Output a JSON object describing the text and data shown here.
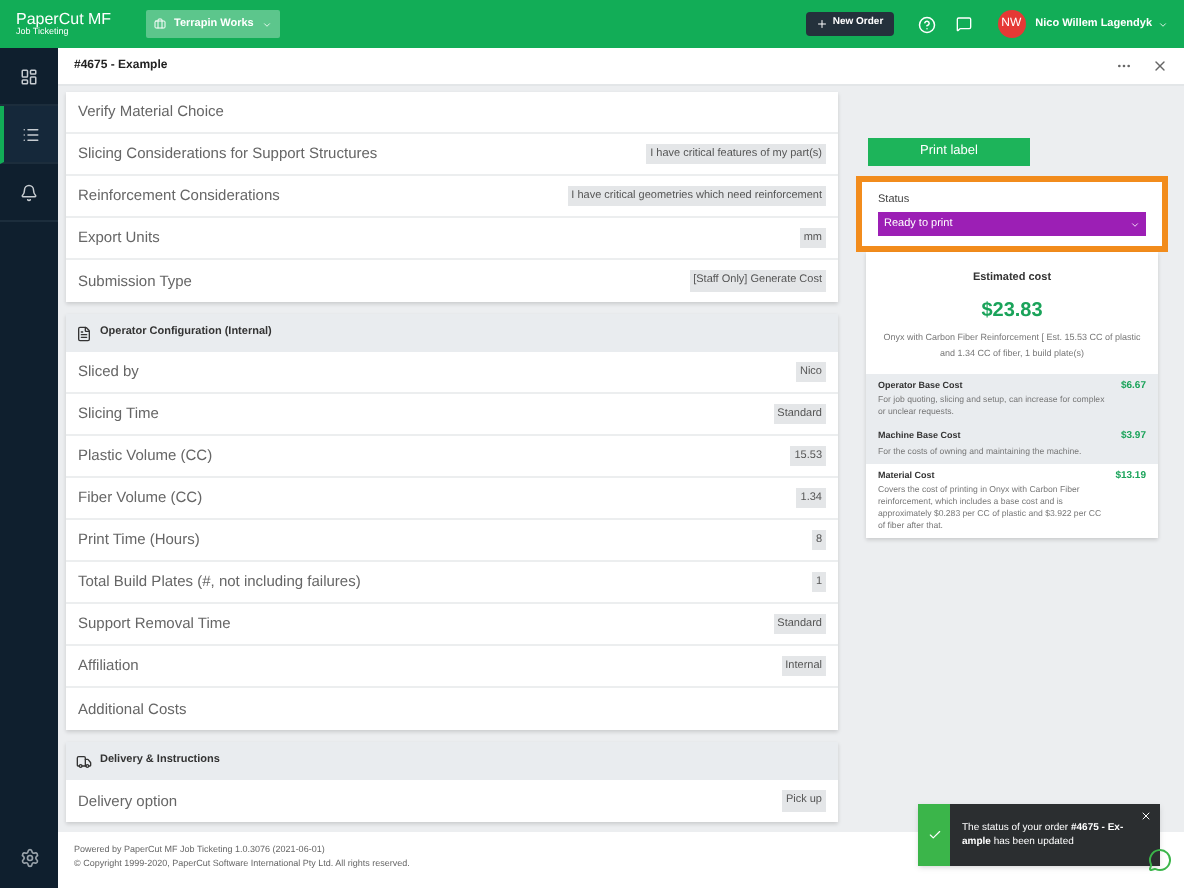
{
  "topbar": {
    "logo": "PaperCut MF",
    "logo_sub": "Job Ticketing",
    "org": "Terrapin Works",
    "new_order": "New Order",
    "avatar": "NW",
    "user": "Nico Willem Lagendyk"
  },
  "sidebar": {
    "items": [
      {
        "kind": "board",
        "selected": false
      },
      {
        "kind": "list",
        "selected": true
      },
      {
        "kind": "bell",
        "selected": false
      }
    ]
  },
  "header": {
    "order": "#4675",
    "separator": "-",
    "title": "Example"
  },
  "sections": [
    {
      "rows": [
        {
          "label": "Verify Material Choice"
        },
        {
          "label": "Slicing Considerations for Support Structures",
          "value": "I have critical features of my part(s)"
        },
        {
          "label": "Reinforcement Considerations",
          "value": "I have critical geometries which need reinforcement"
        },
        {
          "label": "Export Units",
          "value": "mm"
        },
        {
          "label": "Submission Type",
          "value": "[Staff Only] Generate Cost"
        }
      ]
    },
    {
      "title": "Operator Configuration (Internal)",
      "kind": "form",
      "rows": [
        {
          "label": "Sliced by",
          "value": "Nico"
        },
        {
          "label": "Slicing Time",
          "value": "Standard"
        },
        {
          "label": "Plastic Volume (CC)",
          "value": "15.53"
        },
        {
          "label": "Fiber Volume (CC)",
          "value": "1.34"
        },
        {
          "label": "Print Time (Hours)",
          "value": "8"
        },
        {
          "label": "Total Build Plates (#, not including failures)",
          "value": "1"
        },
        {
          "label": "Support Removal Time",
          "value": "Standard"
        },
        {
          "label": "Affiliation",
          "value": "Internal"
        },
        {
          "label": "Additional Costs"
        }
      ]
    },
    {
      "title": "Delivery & Instructions",
      "kind": "truck",
      "rows": [
        {
          "label": "Delivery option",
          "value": "Pick up"
        }
      ]
    }
  ],
  "print_label": "Print label",
  "status": {
    "label": "Status",
    "value": "Ready to print",
    "color": "#9c1fb5"
  },
  "estimate": {
    "title": "Estimated cost",
    "total": "$23.83",
    "description": "Onyx with Carbon Fiber Reinforcement [ Est. 15.53 CC of plastic and 1.34 CC of fiber, 1 build plate(s)",
    "items": [
      {
        "name": "Operator Base Cost",
        "amount": "$6.67",
        "description": "For job quoting, slicing and setup, can increase for complex or unclear requests.",
        "shaded": true
      },
      {
        "name": "Machine Base Cost",
        "amount": "$3.97",
        "description": "For the costs of owning and maintaining the machine.",
        "shaded": true
      },
      {
        "name": "Material Cost",
        "amount": "$13.19",
        "description": "Covers the cost of printing in Onyx with Carbon Fiber reinforcement, which includes a base cost and is approximately $0.283 per CC of plastic and $3.922 per CC of fiber after that.",
        "shaded": false
      }
    ]
  },
  "footer": {
    "powered": "Powered by PaperCut MF Job Ticketing 1.0.3076 (2021-06-01)",
    "copyright": "© Copyright 1999-2020, PaperCut Software International Pty Ltd. All rights reserved."
  },
  "toast": {
    "message": "The status of your order **#4675 - Ex-ample** has been updated"
  }
}
